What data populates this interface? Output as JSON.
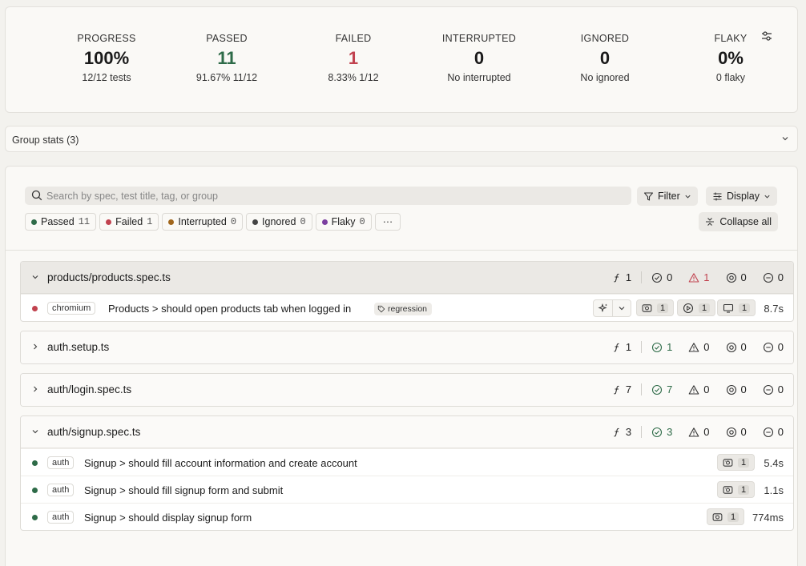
{
  "summary": {
    "progress": {
      "label": "PROGRESS",
      "value": "100%",
      "sub": "12/12 tests"
    },
    "passed": {
      "label": "PASSED",
      "value": "11",
      "sub": "91.67% 11/12"
    },
    "failed": {
      "label": "FAILED",
      "value": "1",
      "sub": "8.33% 1/12"
    },
    "interrupted": {
      "label": "INTERRUPTED",
      "value": "0",
      "sub": "No interrupted"
    },
    "ignored": {
      "label": "IGNORED",
      "value": "0",
      "sub": "No ignored"
    },
    "flaky": {
      "label": "FLAKY",
      "value": "0%",
      "sub": "0 flaky"
    }
  },
  "group_stats": {
    "label": "Group stats (3)"
  },
  "toolbar": {
    "search_placeholder": "Search by spec, test title, tag, or group",
    "filter_label": "Filter",
    "display_label": "Display",
    "collapse_label": "Collapse all"
  },
  "status_filters": [
    {
      "label": "Passed",
      "count": "11",
      "color": "#2e6b48"
    },
    {
      "label": "Failed",
      "count": "1",
      "color": "#c1424f"
    },
    {
      "label": "Interrupted",
      "count": "0",
      "color": "#a0661c"
    },
    {
      "label": "Ignored",
      "count": "0",
      "color": "#444444"
    },
    {
      "label": "Flaky",
      "count": "0",
      "color": "#7b3fa0"
    }
  ],
  "more_label": "···",
  "groups": [
    {
      "name": "products/products.spec.ts",
      "stats": {
        "total": "1",
        "passed": "0",
        "failed": "1",
        "skipped": "0",
        "ignored": "0"
      },
      "tests": [
        {
          "tag": "chromium",
          "title": "Products > should open products tab when logged in",
          "label": "regression",
          "screenshots": "1",
          "videos": "1",
          "traces": "1",
          "duration": "8.7s",
          "status_color": "#c1424f"
        }
      ]
    },
    {
      "name": "auth.setup.ts",
      "stats": {
        "total": "1",
        "passed": "1",
        "failed": "0",
        "skipped": "0",
        "ignored": "0"
      }
    },
    {
      "name": "auth/login.spec.ts",
      "stats": {
        "total": "7",
        "passed": "7",
        "failed": "0",
        "skipped": "0",
        "ignored": "0"
      }
    },
    {
      "name": "auth/signup.spec.ts",
      "stats": {
        "total": "3",
        "passed": "3",
        "failed": "0",
        "skipped": "0",
        "ignored": "0"
      },
      "tests": [
        {
          "tag": "auth",
          "title": "Signup > should fill account information and create account",
          "screenshots": "1",
          "duration": "5.4s",
          "status_color": "#2e6b48"
        },
        {
          "tag": "auth",
          "title": "Signup > should fill signup form and submit",
          "screenshots": "1",
          "duration": "1.1s",
          "status_color": "#2e6b48"
        },
        {
          "tag": "auth",
          "title": "Signup > should display signup form",
          "screenshots": "1",
          "duration": "774ms",
          "status_color": "#2e6b48"
        }
      ]
    }
  ]
}
